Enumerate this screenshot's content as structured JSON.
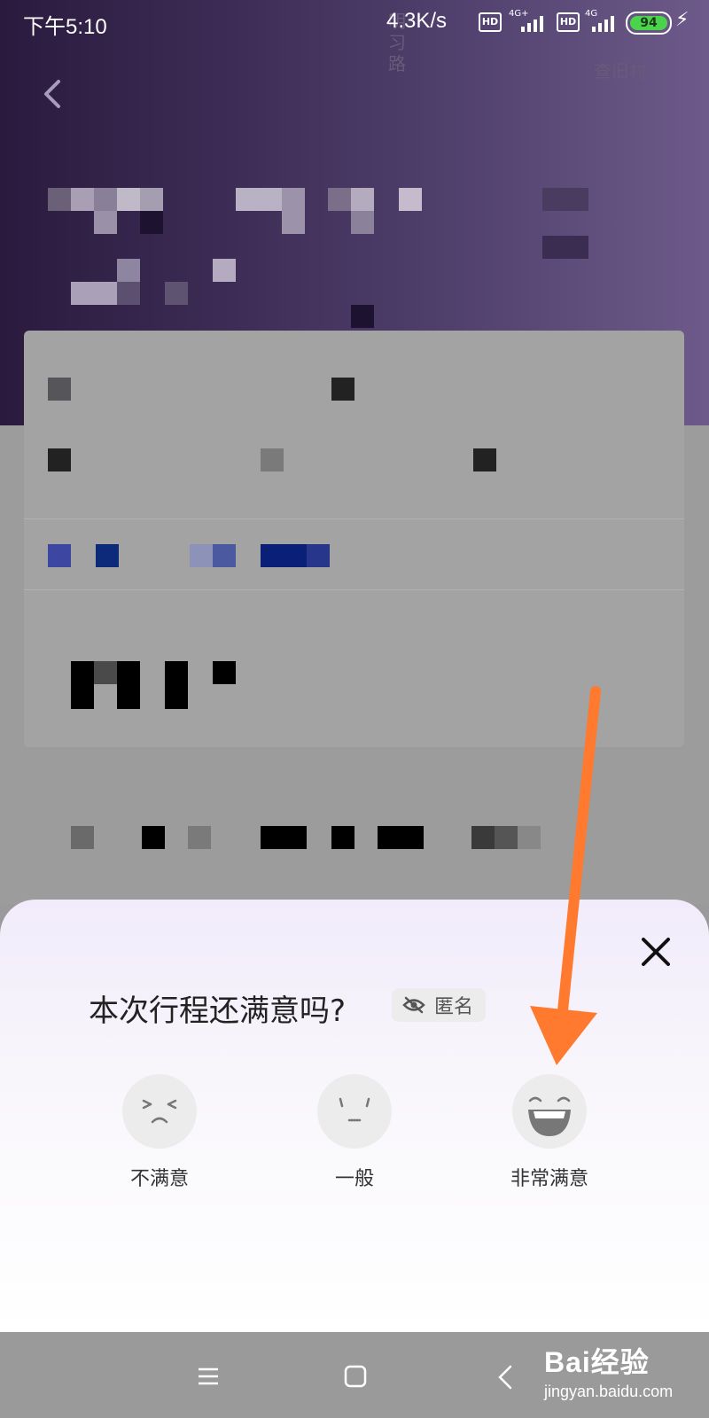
{
  "status_bar": {
    "time": "下午5:10",
    "net_speed": "4.3K/s",
    "hd_badge": "HD",
    "network1": "4G+",
    "network2": "4G",
    "battery": "94"
  },
  "map_labels": {
    "road_1": "明",
    "road_2": "习",
    "road_3": "路",
    "village": "查旧村"
  },
  "rating_sheet": {
    "question": "本次行程还满意吗?",
    "anonymous_label": "匿名",
    "options": [
      {
        "label": "不满意",
        "icon": "angry-face-icon"
      },
      {
        "label": "一般",
        "icon": "neutral-face-icon"
      },
      {
        "label": "非常满意",
        "icon": "very-happy-face-icon"
      }
    ]
  },
  "watermark": {
    "brand": "Bai经验",
    "url": "jingyan.baidu.com"
  },
  "colors": {
    "annotation_arrow": "#ff7a2e",
    "battery": "#4bd34b"
  }
}
